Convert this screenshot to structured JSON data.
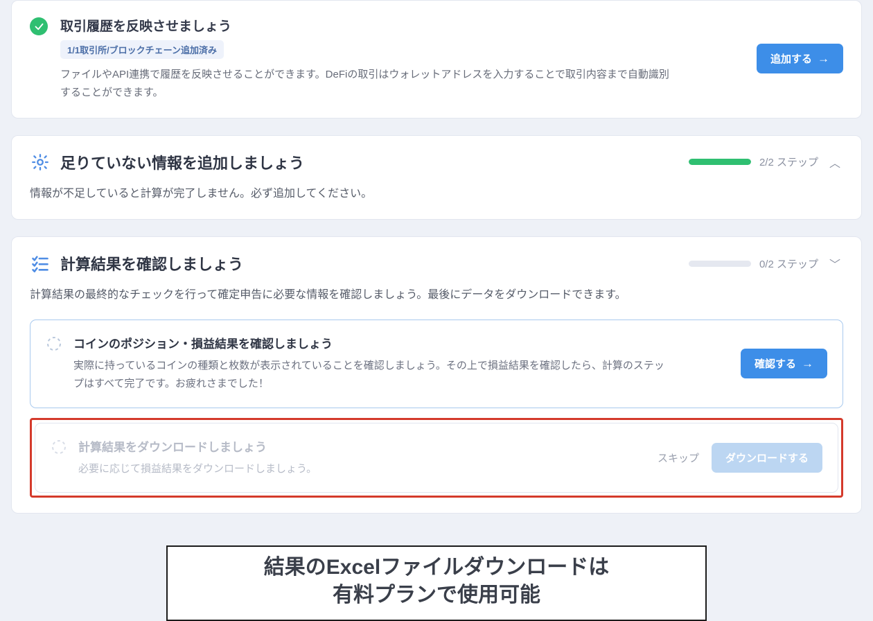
{
  "card1": {
    "title": "取引履歴を反映させましょう",
    "badge": "1/1取引所/ブロックチェーン追加済み",
    "desc": "ファイルやAPI連携で履歴を反映させることができます。DeFiの取引はウォレットアドレスを入力することで取引内容まで自動識別することができます。",
    "button": "追加する"
  },
  "section2": {
    "title": "足りていない情報を追加しましょう",
    "progress_text": "2/2 ステップ",
    "progress_pct": 100,
    "desc": "情報が不足していると計算が完了しません。必ず追加してください。"
  },
  "section3": {
    "title": "計算結果を確認しましょう",
    "progress_text": "0/2 ステップ",
    "progress_pct": 0,
    "desc": "計算結果の最終的なチェックを行って確定申告に必要な情報を確認しましょう。最後にデータをダウンロードできます。",
    "sub1": {
      "title": "コインのポジション・損益結果を確認しましょう",
      "desc": "実際に持っているコインの種類と枚数が表示されていることを確認しましょう。その上で損益結果を確認したら、計算のステップはすべて完了です。お疲れさまでした！",
      "button": "確認する"
    },
    "sub2": {
      "title": "計算結果をダウンロードしましょう",
      "desc": "必要に応じて損益結果をダウンロードしましょう。",
      "skip": "スキップ",
      "button": "ダウンロードする"
    }
  },
  "annotation": {
    "line1": "結果のExcelファイルダウンロードは",
    "line2": "有料プランで使用可能"
  },
  "colors": {
    "accent": "#3d8ee8",
    "success": "#2fbf71",
    "highlight": "#d43a2b"
  }
}
